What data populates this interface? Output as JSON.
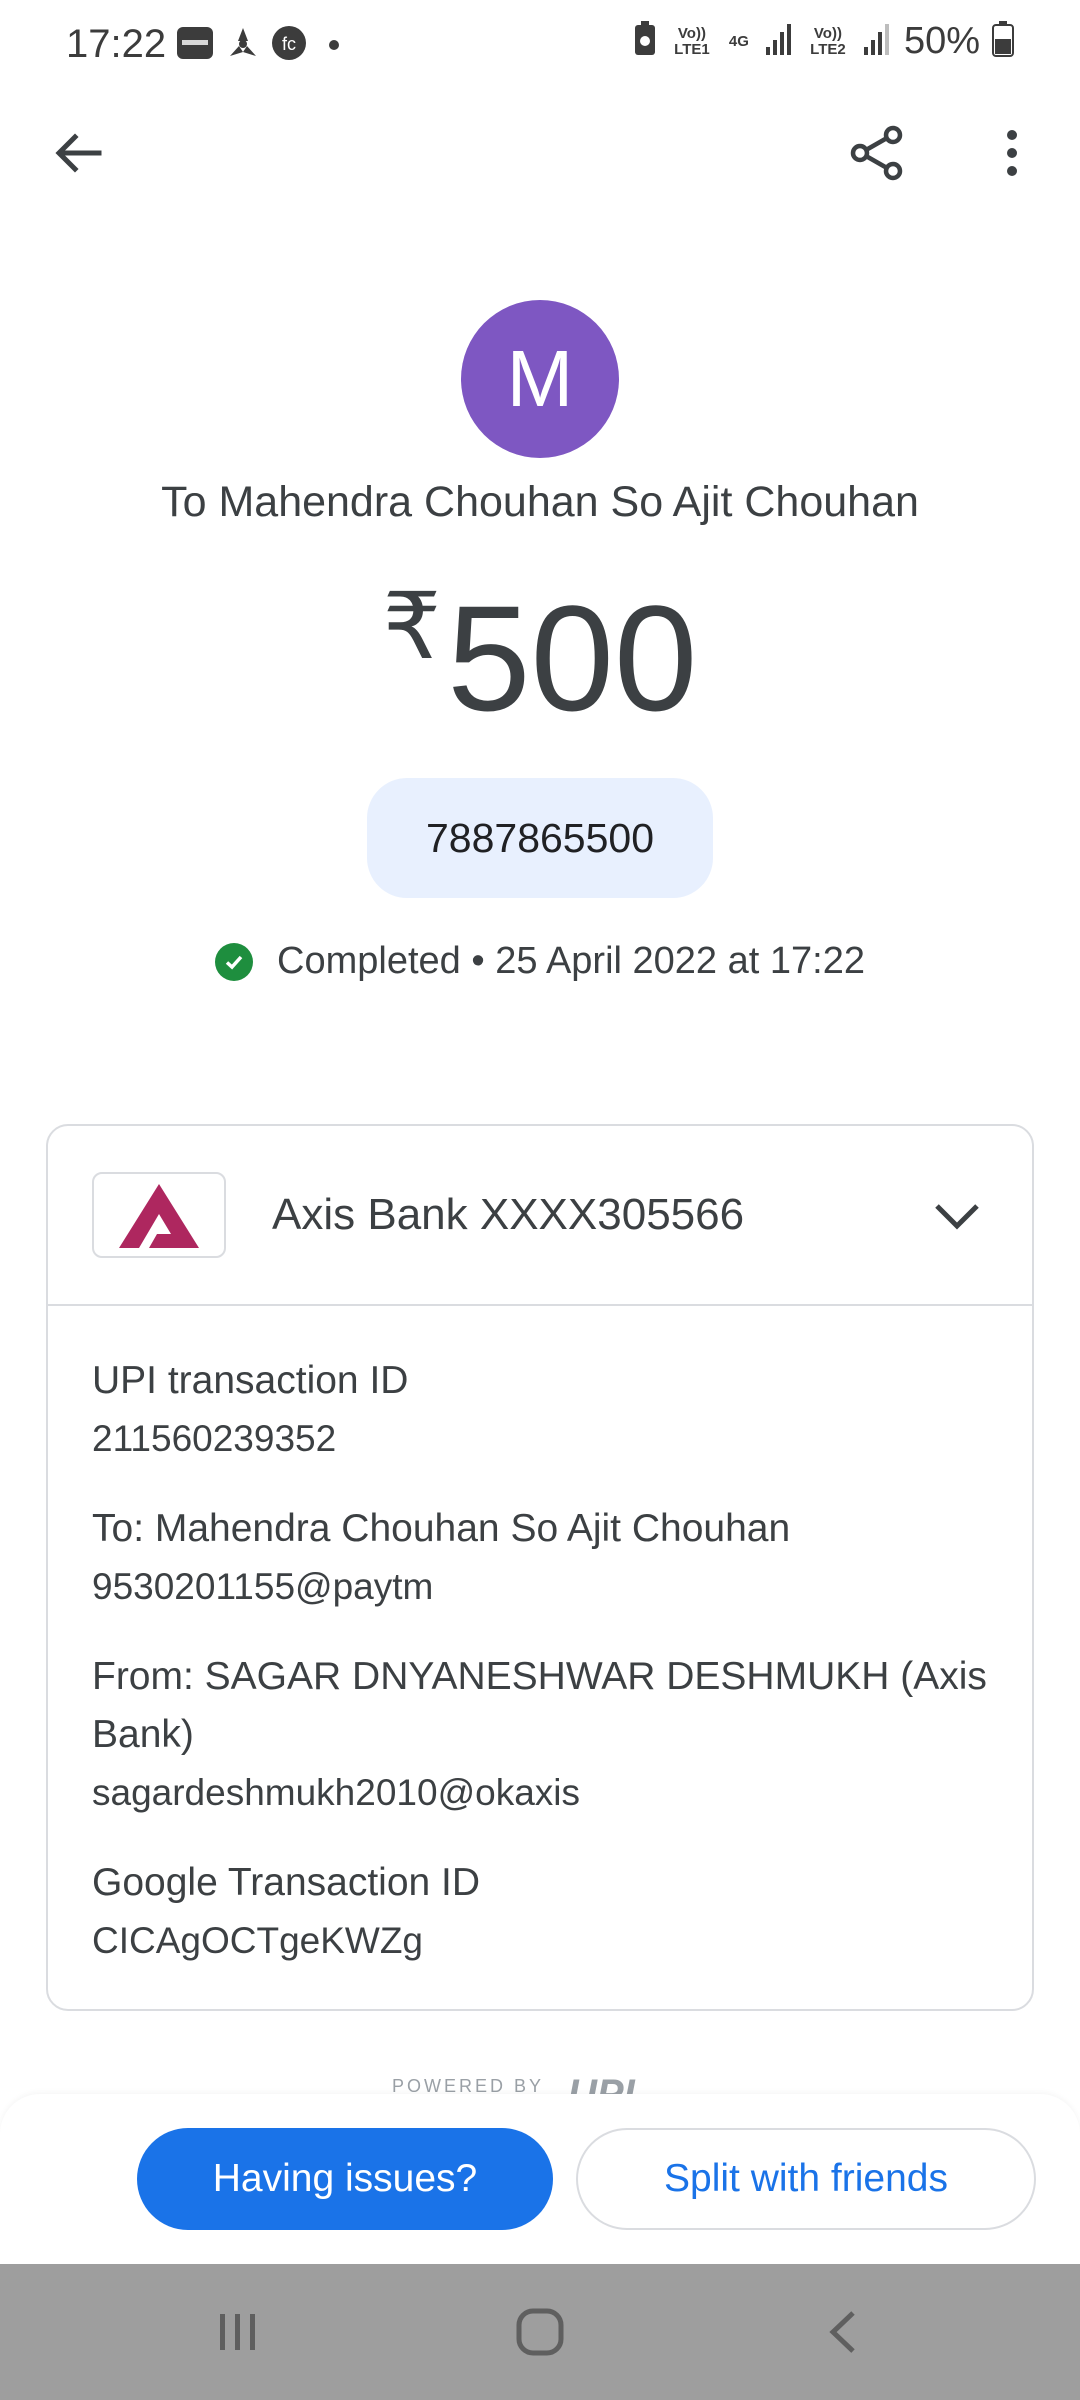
{
  "status_bar": {
    "time": "17:22",
    "battery": "50%",
    "network_1": "Vo)) LTE1",
    "network_2": "Vo)) LTE2",
    "data_type": "4G",
    "notification_icons": [
      "betway-icon",
      "fan-icon",
      "fc-icon",
      "dot-icon"
    ]
  },
  "top_bar": {
    "back_icon": "arrow-left-icon",
    "share_icon": "share-icon",
    "more_icon": "more-vert-icon"
  },
  "payee": {
    "avatar_letter": "M",
    "avatar_color": "#7e57c2",
    "title": "To Mahendra Chouhan So Ajit Chouhan"
  },
  "amount": {
    "currency": "₹",
    "value": "500"
  },
  "phone_chip": "7887865500",
  "status": {
    "text": "Completed • 25 April 2022 at 17:22",
    "color": "#1e8e3e"
  },
  "card": {
    "bank_label": "Axis Bank XXXX305566",
    "bank_logo_color": "#ae275f",
    "details": [
      {
        "label": "UPI transaction ID",
        "value": "211560239352"
      },
      {
        "label": "To: Mahendra Chouhan So Ajit Chouhan",
        "value": "9530201155@paytm"
      },
      {
        "label": "From: SAGAR DNYANESHWAR DESHMUKH (Axis Bank)",
        "value": "sagardeshmukh2010@okaxis"
      },
      {
        "label": "Google Transaction ID",
        "value": "CICAgOCTgeKWZg"
      }
    ]
  },
  "powered_by": {
    "text": "POWERED BY",
    "logo": "UPI"
  },
  "actions": {
    "primary": "Having issues?",
    "secondary": "Split with friends",
    "accent": "#1a73e8"
  },
  "system_nav": [
    "recents-icon",
    "home-icon",
    "back-icon"
  ]
}
